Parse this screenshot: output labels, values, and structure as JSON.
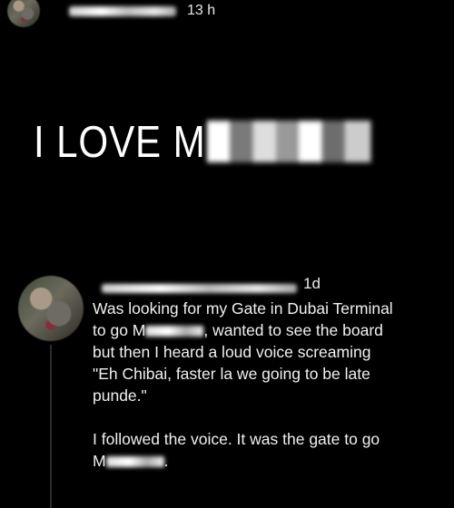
{
  "post": {
    "timestamp": "13 h",
    "caption_visible": "I LOVE M"
  },
  "comment": {
    "timestamp": "1d",
    "line1": "Was looking for my Gate in Dubai Terminal",
    "line2_prefix": "to go M",
    "line2_suffix": ", wanted to see the board",
    "line3": "but then I heard a loud voice screaming",
    "line4": "\"Eh Chibai, faster la we going to be late",
    "line5": "punde.\"",
    "line6": "I followed the voice. It was the gate to go",
    "line7_prefix": "M",
    "line7_suffix": "."
  },
  "colors": {
    "background": "#000000",
    "text": "#f2f2f2"
  }
}
